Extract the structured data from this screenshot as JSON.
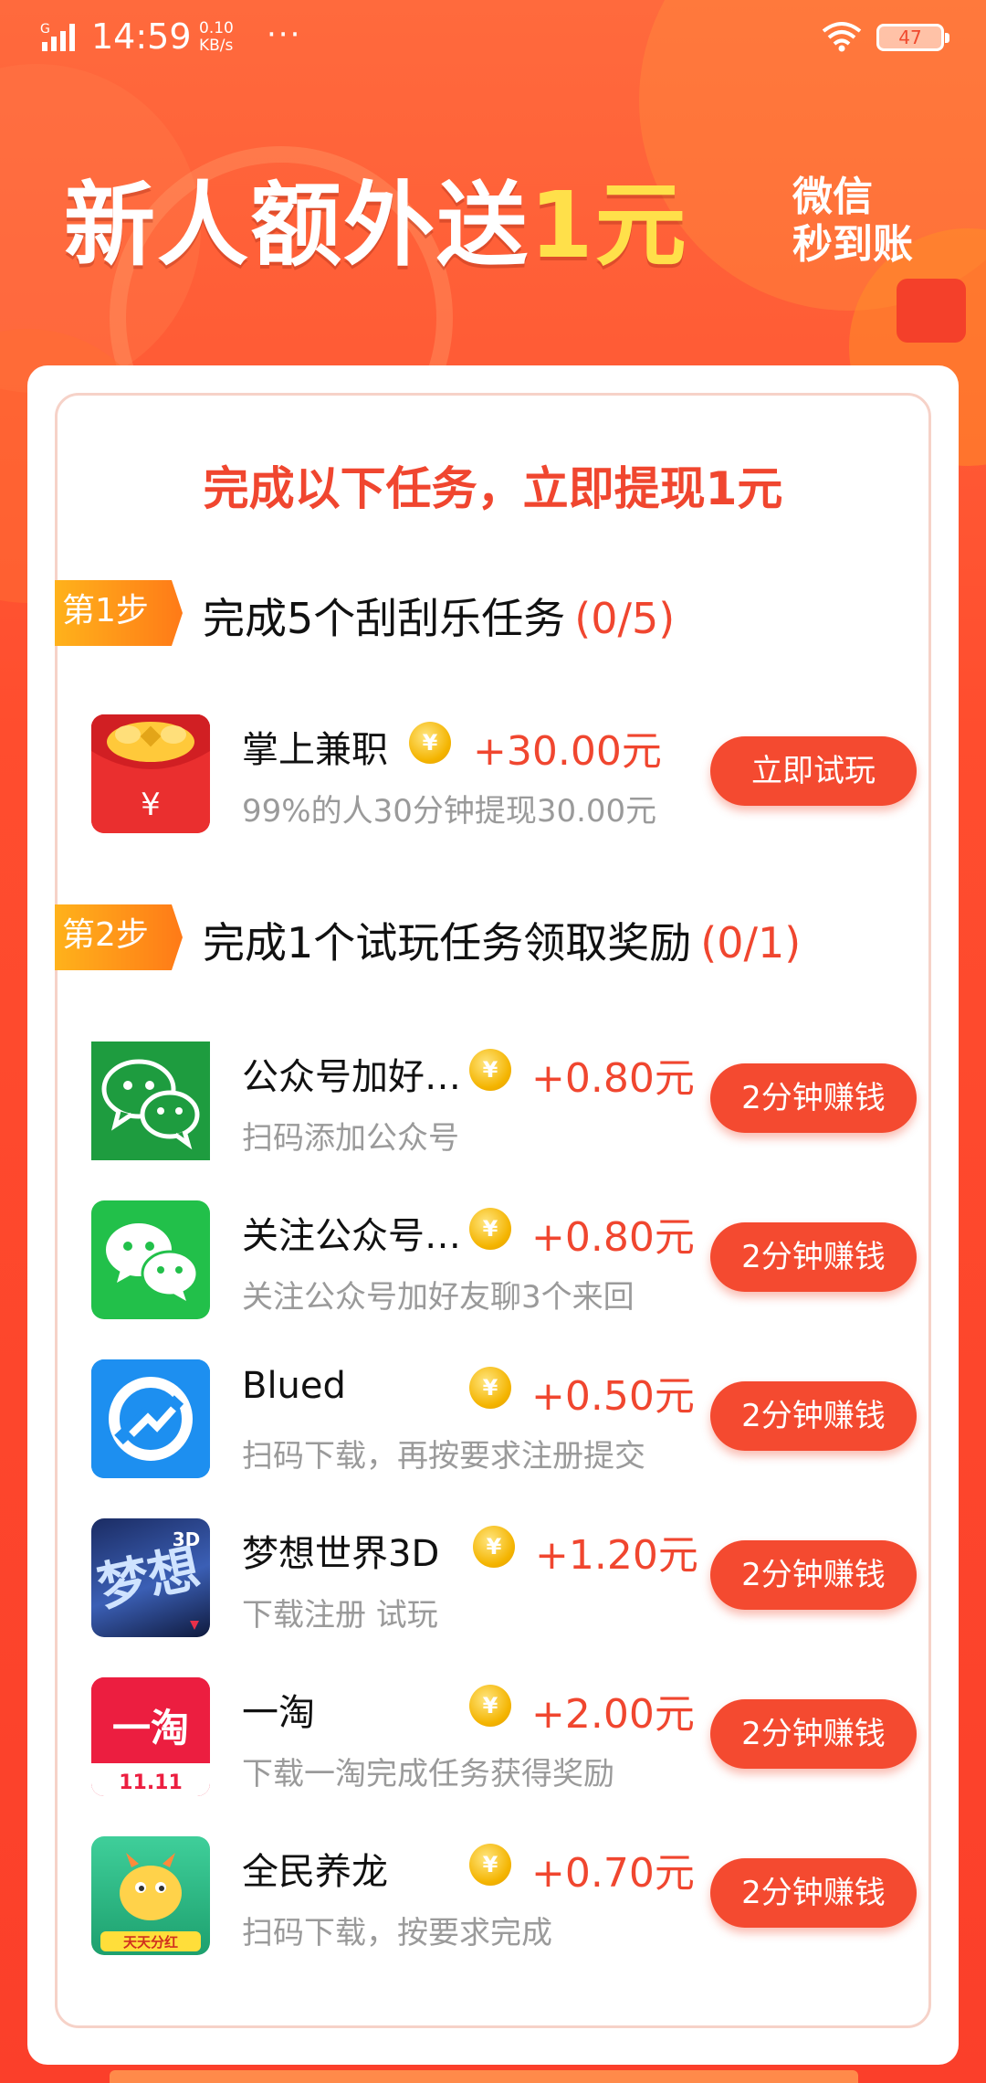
{
  "status_bar": {
    "signal": "G",
    "time": "14:59",
    "speed_value": "0.10",
    "speed_unit": "KB/s",
    "dots": "···",
    "battery": "47"
  },
  "banner": {
    "title_main": "新人额外送",
    "title_highlight": "1元",
    "subtitle_line1": "微信",
    "subtitle_line2": "秒到账"
  },
  "card": {
    "title": "完成以下任务，立即提现1元"
  },
  "steps": [
    {
      "tag": "第1步",
      "label": "完成5个刮刮乐任务",
      "progress": "(0/5)"
    },
    {
      "tag": "第2步",
      "label": "完成1个试玩任务领取奖励",
      "progress": "(0/1)"
    }
  ],
  "tasks": [
    {
      "name": "掌上兼职",
      "coin": "¥",
      "amount": "+30.00元",
      "desc": "99%的人30分钟提现30.00元",
      "button": "立即试玩",
      "icon": "red-envelope-icon"
    },
    {
      "name": "公众号加好…",
      "coin": "¥",
      "amount": "+0.80元",
      "desc": "扫码添加公众号",
      "button": "2分钟赚钱",
      "icon": "wechat-icon"
    },
    {
      "name": "关注公众号…",
      "coin": "¥",
      "amount": "+0.80元",
      "desc": "关注公众号加好友聊3个来回",
      "button": "2分钟赚钱",
      "icon": "wechat-icon"
    },
    {
      "name": "Blued",
      "coin": "¥",
      "amount": "+0.50元",
      "desc": "扫码下载，再按要求注册提交",
      "button": "2分钟赚钱",
      "icon": "blued-icon"
    },
    {
      "name": "梦想世界3D",
      "coin": "¥",
      "amount": "+1.20元",
      "desc": "下载注册 试玩",
      "button": "2分钟赚钱",
      "icon": "dream-world-icon"
    },
    {
      "name": "一淘",
      "coin": "¥",
      "amount": "+2.00元",
      "desc": "下载一淘完成任务获得奖励",
      "button": "2分钟赚钱",
      "icon": "yitao-icon"
    },
    {
      "name": "全民养龙",
      "coin": "¥",
      "amount": "+0.70元",
      "desc": "扫码下载，按要求完成",
      "button": "2分钟赚钱",
      "icon": "dragon-icon"
    }
  ],
  "icon_texts": {
    "yitao_logo": "一淘",
    "yitao_sub": "11.11",
    "dream_logo": "梦想",
    "dream_3d": "3D",
    "dragon_badge": "天天分红"
  },
  "colors": {
    "accent": "#f0462f",
    "button": "#f44a30",
    "step_tag": "#ff9a1a",
    "highlight": "#ffe04a",
    "background": "#fc4a2c"
  }
}
